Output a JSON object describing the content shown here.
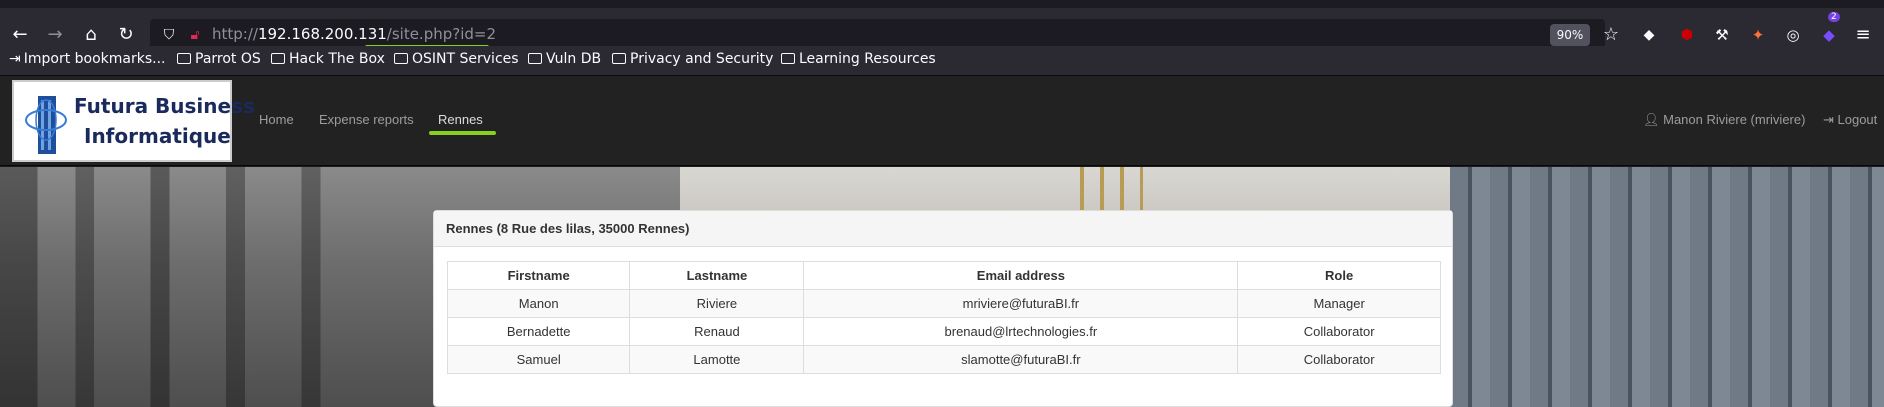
{
  "browser": {
    "url_prefix": "http://",
    "url_host": "192.168.200.131",
    "url_path": "/site.php?id=2",
    "zoom": "90%",
    "extension_badge": "2",
    "bookmarks": [
      {
        "label": "Import bookmarks...",
        "icon": "import-icon"
      },
      {
        "label": "Parrot OS",
        "icon": "folder-icon"
      },
      {
        "label": "Hack The Box",
        "icon": "folder-icon"
      },
      {
        "label": "OSINT Services",
        "icon": "folder-icon"
      },
      {
        "label": "Vuln DB",
        "icon": "folder-icon"
      },
      {
        "label": "Privacy and Security",
        "icon": "folder-icon"
      },
      {
        "label": "Learning Resources",
        "icon": "folder-icon"
      }
    ]
  },
  "site": {
    "logo_line1": "Futura Business",
    "logo_line2": "Informatique",
    "nav": [
      "Home",
      "Expense reports",
      "Rennes"
    ],
    "active_nav": "Rennes",
    "user": "Manon Riviere (mriviere)",
    "logout": "Logout"
  },
  "panel": {
    "title": "Rennes (8 Rue des lilas, 35000 Rennes)",
    "columns": [
      "Firstname",
      "Lastname",
      "Email address",
      "Role"
    ],
    "rows": [
      [
        "Manon",
        "Riviere",
        "mriviere@futuraBI.fr",
        "Manager"
      ],
      [
        "Bernadette",
        "Renaud",
        "brenaud@lrtechnologies.fr",
        "Collaborator"
      ],
      [
        "Samuel",
        "Lamotte",
        "slamotte@futuraBI.fr",
        "Collaborator"
      ]
    ]
  },
  "colors": {
    "accent_underline": "#86d11d",
    "navbar_bg": "#222222",
    "browser_bg": "#2b2a33"
  }
}
